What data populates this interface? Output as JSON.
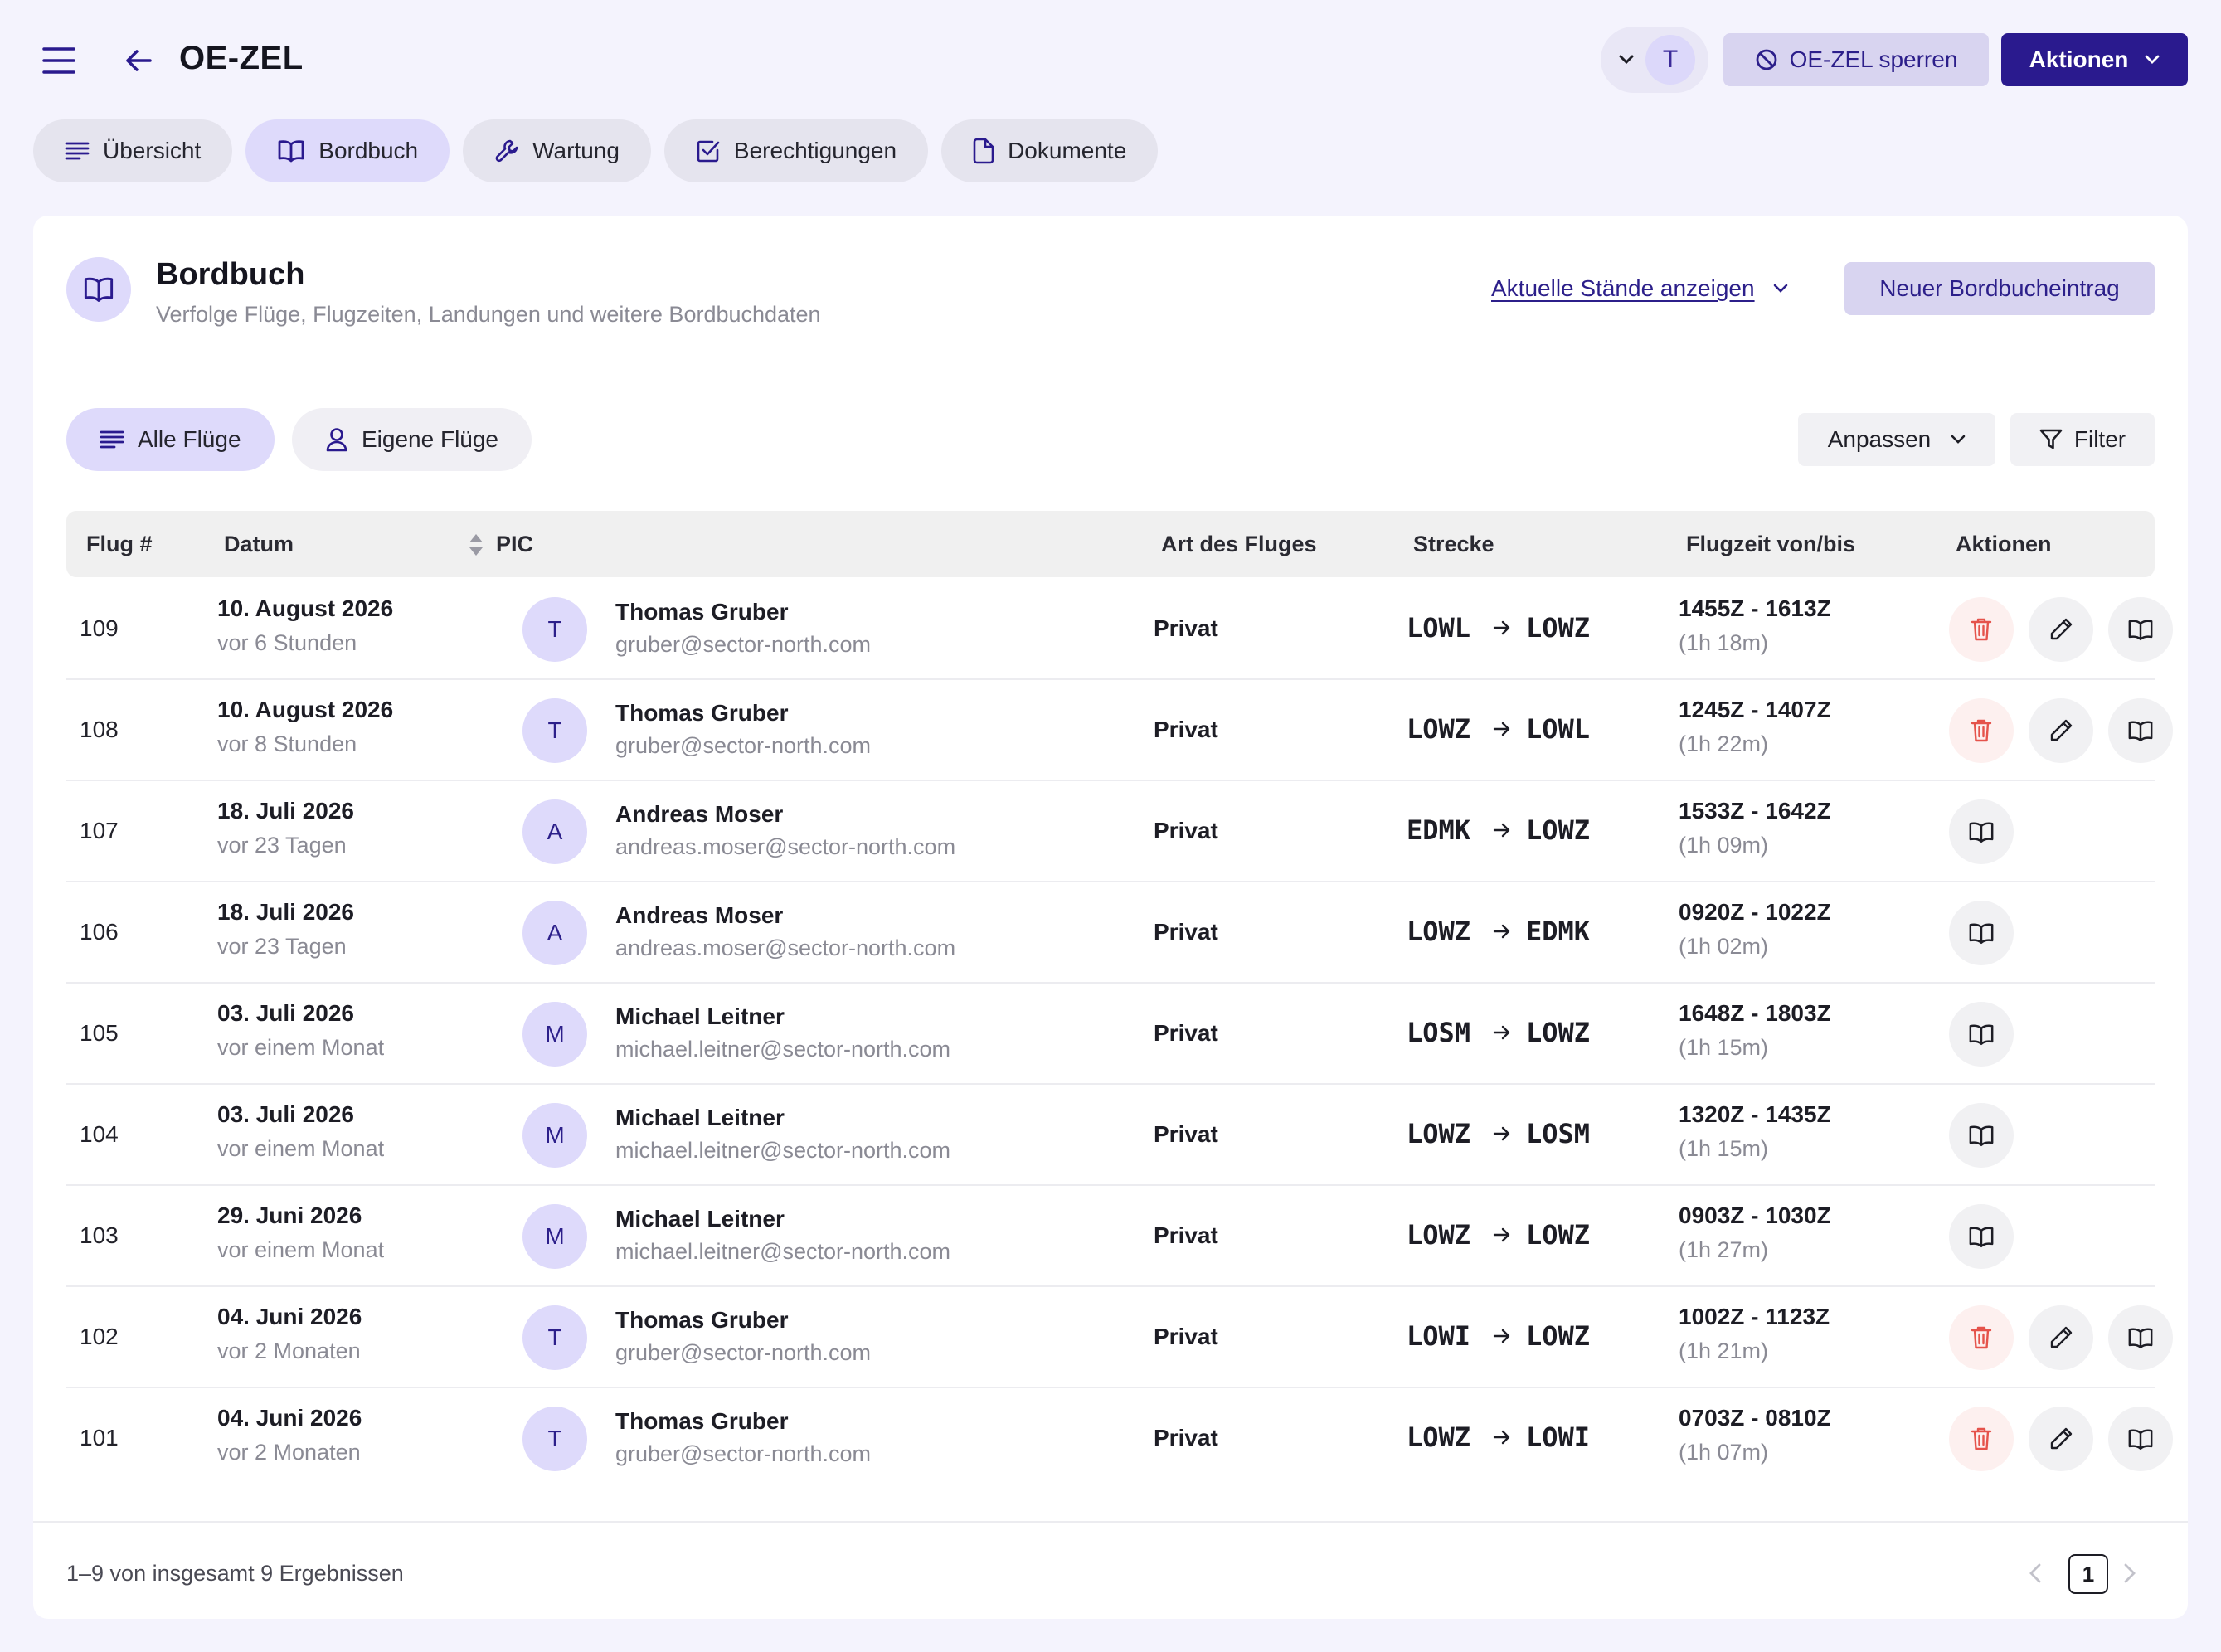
{
  "header": {
    "title": "OE-ZEL",
    "user_initial": "T",
    "lock_label": "OE-ZEL sperren",
    "actions_label": "Aktionen"
  },
  "tabs": [
    {
      "label": "Übersicht",
      "icon": "list-icon"
    },
    {
      "label": "Bordbuch",
      "icon": "book-icon",
      "active": true
    },
    {
      "label": "Wartung",
      "icon": "wrench-icon"
    },
    {
      "label": "Berechtigungen",
      "icon": "checkbox-icon"
    },
    {
      "label": "Dokumente",
      "icon": "document-icon"
    }
  ],
  "card": {
    "title": "Bordbuch",
    "subtitle": "Verfolge Flüge, Flugzeiten, Landungen und weitere Bordbuchdaten",
    "current_link": "Aktuelle Stände anzeigen",
    "new_button": "Neuer Bordbucheintrag"
  },
  "filters": {
    "all_flights": "Alle Flüge",
    "own_flights": "Eigene Flüge",
    "customize": "Anpassen",
    "filter": "Filter"
  },
  "table": {
    "columns": [
      "Flug #",
      "Datum",
      "PIC",
      "Art des Fluges",
      "Strecke",
      "Flugzeit von/bis",
      "Aktionen"
    ],
    "rows": [
      {
        "num": "109",
        "date": "10. August 2026",
        "ago": "vor 6 Stunden",
        "initial": "T",
        "pic": "Thomas Gruber",
        "email": "gruber@sector-north.com",
        "type": "Privat",
        "from": "LOWL",
        "to": "LOWZ",
        "time": "1455Z - 1613Z",
        "duration": "(1h 18m)",
        "editable": true
      },
      {
        "num": "108",
        "date": "10. August 2026",
        "ago": "vor 8 Stunden",
        "initial": "T",
        "pic": "Thomas Gruber",
        "email": "gruber@sector-north.com",
        "type": "Privat",
        "from": "LOWZ",
        "to": "LOWL",
        "time": "1245Z - 1407Z",
        "duration": "(1h 22m)",
        "editable": true
      },
      {
        "num": "107",
        "date": "18. Juli 2026",
        "ago": "vor 23 Tagen",
        "initial": "A",
        "pic": "Andreas Moser",
        "email": "andreas.moser@sector-north.com",
        "type": "Privat",
        "from": "EDMK",
        "to": "LOWZ",
        "time": "1533Z - 1642Z",
        "duration": "(1h 09m)",
        "editable": false
      },
      {
        "num": "106",
        "date": "18. Juli 2026",
        "ago": "vor 23 Tagen",
        "initial": "A",
        "pic": "Andreas Moser",
        "email": "andreas.moser@sector-north.com",
        "type": "Privat",
        "from": "LOWZ",
        "to": "EDMK",
        "time": "0920Z - 1022Z",
        "duration": "(1h 02m)",
        "editable": false
      },
      {
        "num": "105",
        "date": "03. Juli 2026",
        "ago": "vor einem Monat",
        "initial": "M",
        "pic": "Michael Leitner",
        "email": "michael.leitner@sector-north.com",
        "type": "Privat",
        "from": "LOSM",
        "to": "LOWZ",
        "time": "1648Z - 1803Z",
        "duration": "(1h 15m)",
        "editable": false
      },
      {
        "num": "104",
        "date": "03. Juli 2026",
        "ago": "vor einem Monat",
        "initial": "M",
        "pic": "Michael Leitner",
        "email": "michael.leitner@sector-north.com",
        "type": "Privat",
        "from": "LOWZ",
        "to": "LOSM",
        "time": "1320Z - 1435Z",
        "duration": "(1h 15m)",
        "editable": false
      },
      {
        "num": "103",
        "date": "29. Juni 2026",
        "ago": "vor einem Monat",
        "initial": "M",
        "pic": "Michael Leitner",
        "email": "michael.leitner@sector-north.com",
        "type": "Privat",
        "from": "LOWZ",
        "to": "LOWZ",
        "time": "0903Z - 1030Z",
        "duration": "(1h 27m)",
        "editable": false
      },
      {
        "num": "102",
        "date": "04. Juni 2026",
        "ago": "vor 2 Monaten",
        "initial": "T",
        "pic": "Thomas Gruber",
        "email": "gruber@sector-north.com",
        "type": "Privat",
        "from": "LOWI",
        "to": "LOWZ",
        "time": "1002Z - 1123Z",
        "duration": "(1h 21m)",
        "editable": true
      },
      {
        "num": "101",
        "date": "04. Juni 2026",
        "ago": "vor 2 Monaten",
        "initial": "T",
        "pic": "Thomas Gruber",
        "email": "gruber@sector-north.com",
        "type": "Privat",
        "from": "LOWZ",
        "to": "LOWI",
        "time": "0703Z - 0810Z",
        "duration": "(1h 07m)",
        "editable": true
      }
    ]
  },
  "footer": {
    "results": "1–9 von insgesamt 9 Ergebnissen",
    "page": "1"
  },
  "colors": {
    "accent": "#2a1a8e",
    "accent_soft": "#dedafb",
    "delete": "#e5534b",
    "background": "#f4f3fd"
  }
}
